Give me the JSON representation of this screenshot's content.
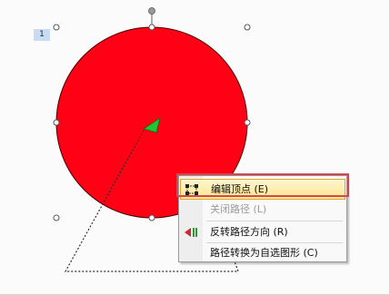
{
  "slide": {
    "number_label": "1"
  },
  "context_menu": {
    "items": [
      {
        "label": "编辑顶点 (E)",
        "icon": "edit-points-icon",
        "state": "highlighted"
      },
      {
        "label": "关闭路径 (L)",
        "icon": "",
        "state": "disabled"
      },
      {
        "label": "反转路径方向 (R)",
        "icon": "reverse-path-icon",
        "state": "normal"
      },
      {
        "label": "路径转换为自选图形 (C)",
        "icon": "",
        "state": "normal"
      }
    ]
  },
  "colors": {
    "circle_fill": "#ff0015",
    "handle": "#ffffff",
    "arrow_green": "#22c534",
    "highlight_border": "#d2484e"
  }
}
